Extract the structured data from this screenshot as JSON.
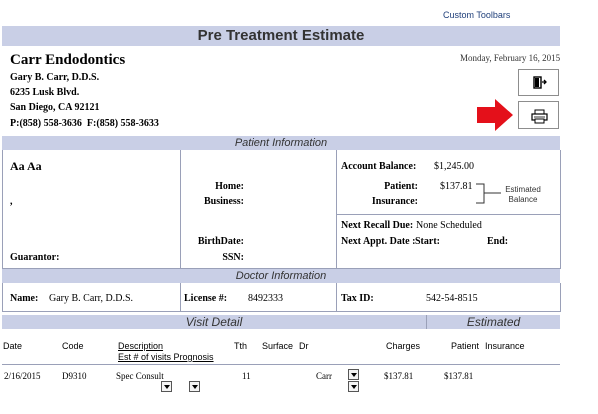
{
  "toolbar": {
    "custom_toolbars": "Custom Toolbars"
  },
  "title": "Pre Treatment Estimate",
  "date": "Monday, February 16, 2015",
  "practice": {
    "name": "Carr Endodontics",
    "doctor": "Gary B. Carr, D.D.S.",
    "address1": "6235 Lusk Blvd.",
    "address2": "San Diego, CA 92121",
    "phones": "P:(858) 558-3636  F:(858) 558-3633"
  },
  "sections": {
    "patient_info": "Patient Information",
    "doctor_info": "Doctor Information",
    "visit_detail": "Visit Detail",
    "estimated": "Estimated"
  },
  "patient": {
    "name": "Aa Aa",
    "comma": ",",
    "home_label": "Home:",
    "business_label": "Business:",
    "birthdate_label": "BirthDate:",
    "ssn_label": "SSN:",
    "guarantor_label": "Guarantor:"
  },
  "account": {
    "balance_label": "Account Balance:",
    "balance_value": "$1,245.00",
    "patient_label": "Patient:",
    "patient_value": "$137.81",
    "insurance_label": "Insurance:",
    "estimated_note_1": "Estimated",
    "estimated_note_2": "Balance",
    "recall_label": "Next Recall Due:",
    "recall_value": "None Scheduled",
    "appt_label": "Next Appt. Date :",
    "start_label": "Start:",
    "end_label": "End:"
  },
  "doctor": {
    "name_label": "Name:",
    "name_value": "Gary B. Carr, D.D.S.",
    "license_label": "License #:",
    "license_value": "8492333",
    "taxid_label": "Tax ID:",
    "taxid_value": "542-54-8515"
  },
  "columns": {
    "date": "Date",
    "code": "Code",
    "description": "Description",
    "est_visits": "Est # of visits Prognosis",
    "tth": "Tth",
    "surface": "Surface",
    "dr": "Dr",
    "charges": "Charges",
    "patient": "Patient",
    "insurance": "Insurance"
  },
  "rows": [
    {
      "date": "2/16/2015",
      "code": "D9310",
      "description": "Spec Consult",
      "tth": "11",
      "dr": "Carr",
      "charges": "$137.81",
      "patient": "$137.81"
    }
  ]
}
